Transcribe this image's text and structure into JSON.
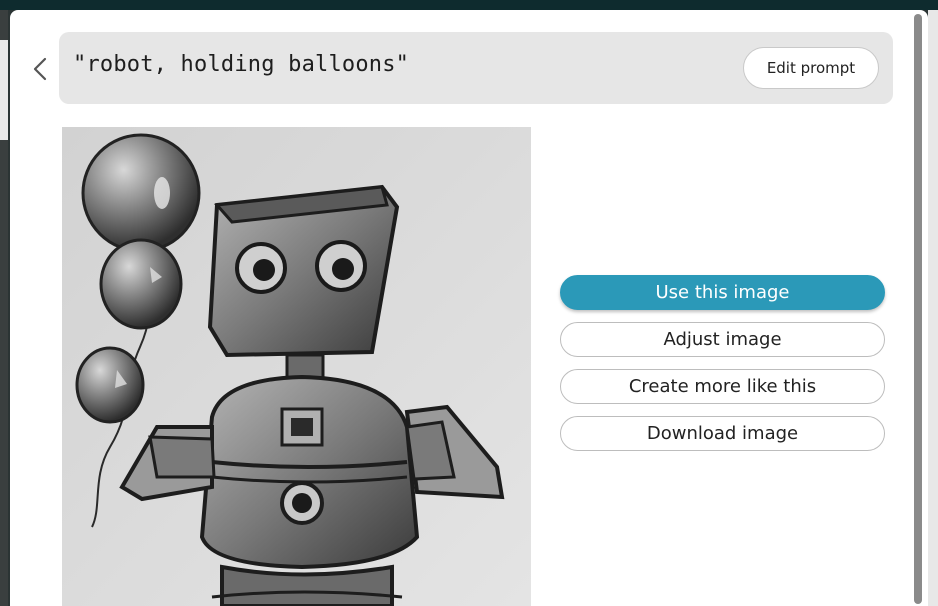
{
  "prompt": {
    "text": "\"robot, holding balloons\"",
    "edit_label": "Edit prompt"
  },
  "image": {
    "alt": "robot, holding balloons"
  },
  "actions": [
    {
      "label": "Use this image",
      "style": "primary"
    },
    {
      "label": "Adjust image",
      "style": "outline"
    },
    {
      "label": "Create more like this",
      "style": "outline"
    },
    {
      "label": "Download image",
      "style": "outline"
    }
  ],
  "colors": {
    "accent": "#2b99b8",
    "prompt_bar": "#e6e6e6"
  },
  "icons": {
    "back": "chevron-left-icon"
  }
}
